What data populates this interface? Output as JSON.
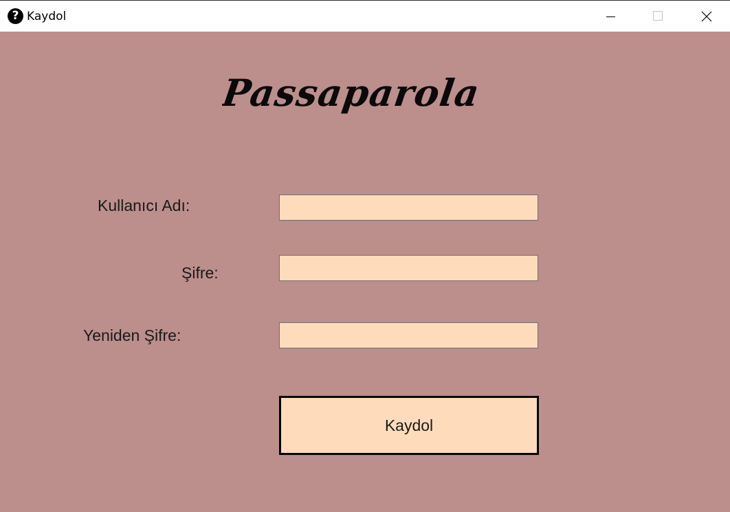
{
  "window": {
    "title": "Kaydol",
    "app_icon": "help-question-icon",
    "controls": {
      "minimize_icon": "minimize-icon",
      "maximize_icon": "maximize-icon",
      "close_icon": "close-icon"
    }
  },
  "app": {
    "logo_text": "Passaparola"
  },
  "form": {
    "username": {
      "label": "Kullanıcı Adı:",
      "value": ""
    },
    "password": {
      "label": "Şifre:",
      "value": ""
    },
    "password_repeat": {
      "label": "Yeniden Şifre:",
      "value": ""
    },
    "submit_label": "Kaydol"
  },
  "colors": {
    "background": "#bc8e8c",
    "field_background": "#fedbbb",
    "titlebar": "#ffffff",
    "text": "#1a1a1a"
  }
}
